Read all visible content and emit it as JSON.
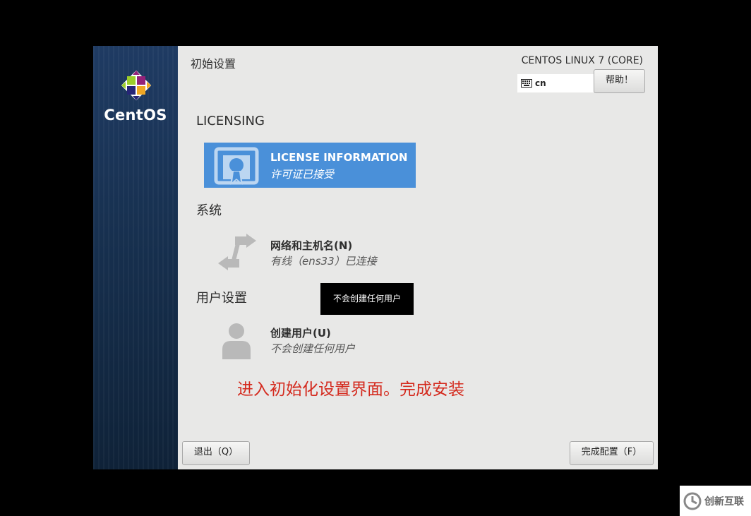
{
  "window": {
    "title": "初始设置",
    "product": "CENTOS LINUX 7 (CORE)",
    "keyboard_layout": "cn",
    "help_label": "帮助！"
  },
  "sidebar": {
    "logo_text": "CentOS",
    "logo_icon": "centos-logo-icon"
  },
  "sections": [
    {
      "title": "LICENSING"
    },
    {
      "title": "系统"
    },
    {
      "title": "用户设置"
    }
  ],
  "spokes": [
    {
      "title": "LICENSE INFORMATION",
      "status": "许可证已接受",
      "icon": "license-icon",
      "selected": true
    },
    {
      "title": "网络和主机名(N)",
      "status": "有线（ens33）已连接",
      "icon": "network-icon",
      "selected": false
    },
    {
      "title": "创建用户(U)",
      "status": "不会创建任何用户",
      "icon": "user-icon",
      "selected": false
    }
  ],
  "tooltip": "不会创建任何用户",
  "overlay_text": "进入初始化设置界面。完成安装",
  "footer": {
    "quit_label": "退出（Q）",
    "finish_label": "完成配置（F）"
  },
  "watermark": {
    "text": "创新互联"
  },
  "colors": {
    "accent": "#4a90d9",
    "sidebar": "#1f3b63",
    "overlay_text": "#d42a1e"
  }
}
